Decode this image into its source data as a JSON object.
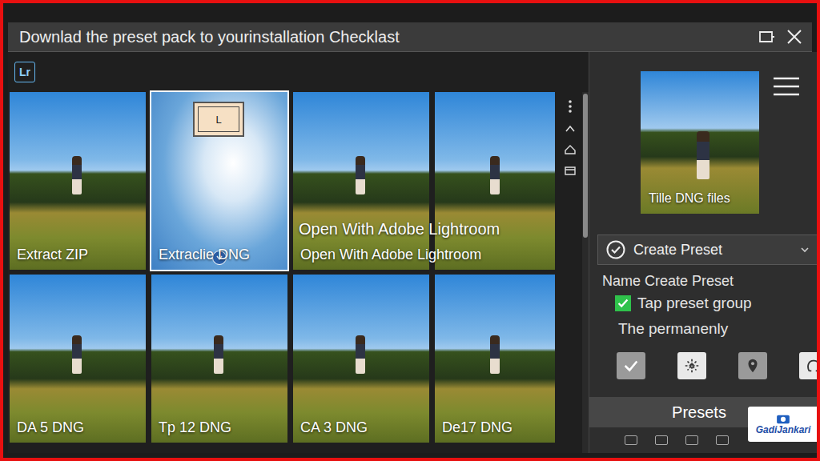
{
  "window": {
    "title": "Downlad the preset pack to yourinstallation Checklast"
  },
  "app_badge": "Lr",
  "tiles": [
    {
      "kind": "photo",
      "label": "Extract ZIP",
      "selected": false
    },
    {
      "kind": "sky",
      "label": "Extraclie DNG",
      "selected": true,
      "dialog": "L"
    },
    {
      "kind": "photo",
      "headline": "Open With Adobe Lightroom",
      "label": "Open With Adobe Lightroom",
      "selected": false
    },
    {
      "kind": "photo",
      "selected": false
    },
    {
      "kind": "photo",
      "label": "DA 5 DNG",
      "selected": false
    },
    {
      "kind": "photo",
      "label": "Tp 12 DNG",
      "selected": false
    },
    {
      "kind": "photo",
      "label": "CA 3 DNG",
      "selected": false
    },
    {
      "kind": "photo",
      "label": "De17 DNG",
      "selected": false
    }
  ],
  "side_panel": {
    "preview_label": "Tille DNG files",
    "dropdown": {
      "label": "Create Preset"
    },
    "name_label": "Name Create Preset",
    "checkbox": {
      "label": "Tap preset group",
      "checked": true
    },
    "note": "The permanenly",
    "tools": [
      {
        "selected": true
      },
      {
        "selected": false
      },
      {
        "selected": true
      },
      {
        "selected": false
      }
    ]
  },
  "presets_bar": {
    "label": "Presets"
  },
  "watermark": {
    "text": "GadiJankari"
  }
}
